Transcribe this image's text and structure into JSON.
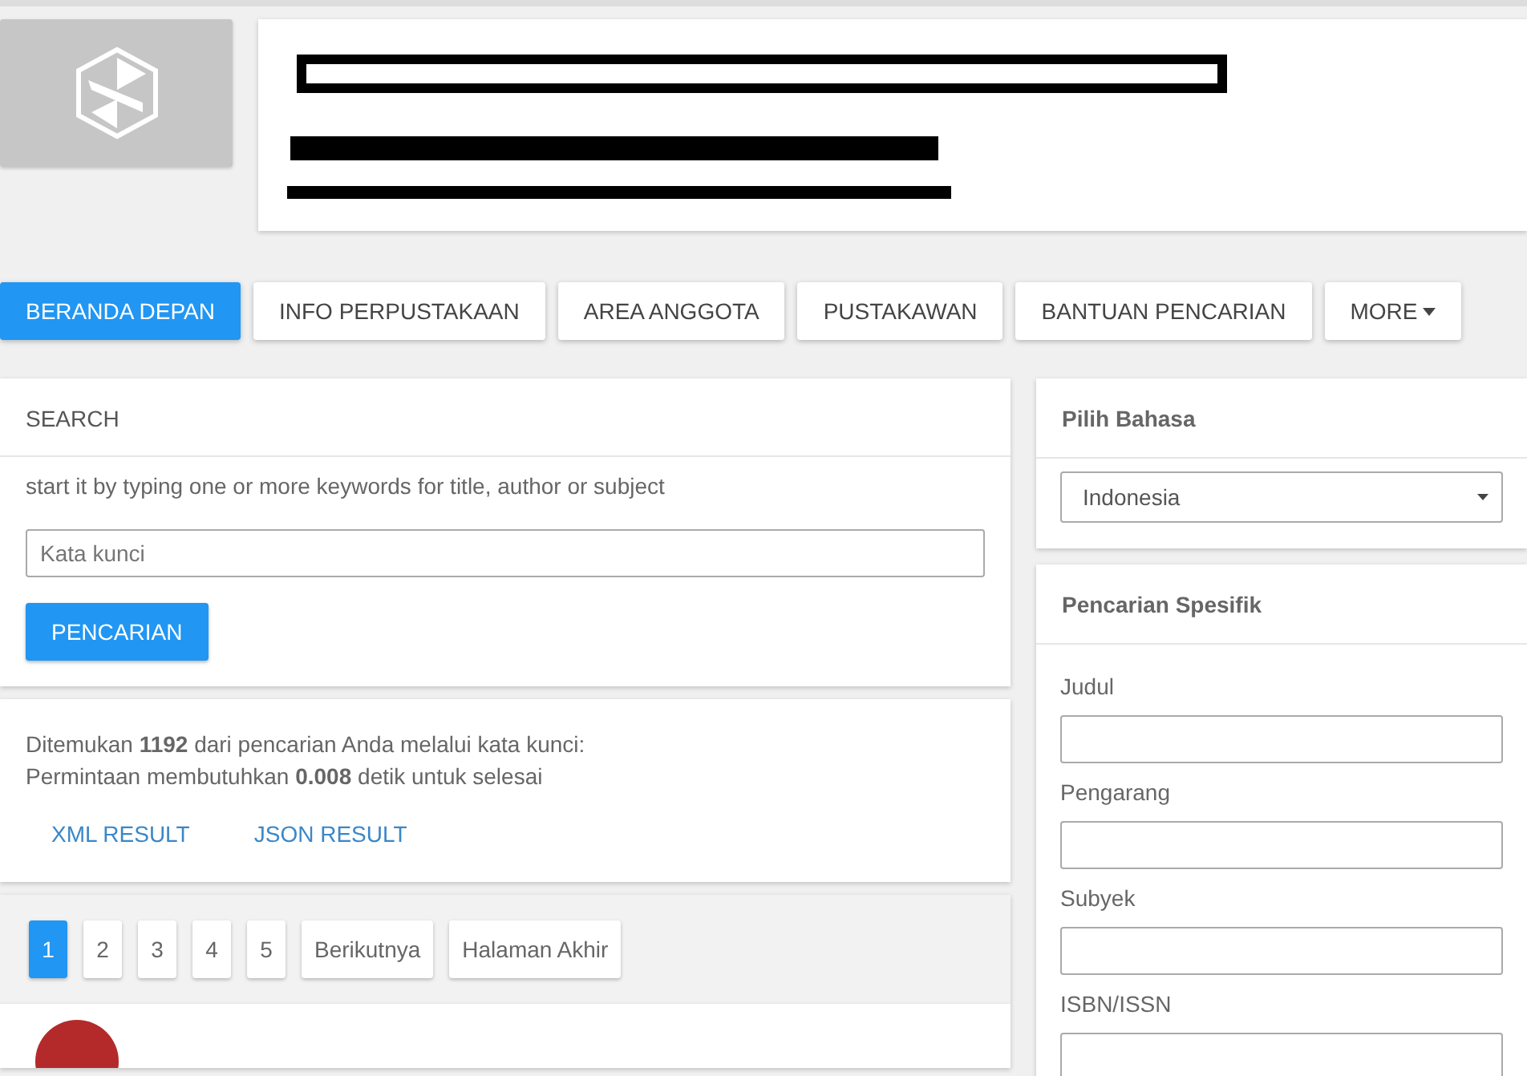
{
  "nav": [
    {
      "label": "BERANDA DEPAN",
      "selected": true
    },
    {
      "label": "INFO PERPUSTAKAAN",
      "selected": false
    },
    {
      "label": "AREA ANGGOTA",
      "selected": false
    },
    {
      "label": "PUSTAKAWAN",
      "selected": false
    },
    {
      "label": "BANTUAN PENCARIAN",
      "selected": false
    },
    {
      "label": "MORE",
      "selected": false,
      "dropdown": true
    }
  ],
  "search": {
    "title": "SEARCH",
    "hint": "start it by typing one or more keywords for title, author or subject",
    "placeholder": "Kata kunci",
    "button": "PENCARIAN"
  },
  "results_info": {
    "lines": [
      "Ditemukan **1192** dari pencarian Anda melalui kata kunci:",
      "Permintaan membutuhkan **0.008** detik untuk selesai"
    ],
    "links": [
      "XML RESULT",
      "JSON RESULT"
    ]
  },
  "pagination": [
    {
      "label": "1",
      "selected": true
    },
    {
      "label": "2",
      "selected": false
    },
    {
      "label": "3",
      "selected": false
    },
    {
      "label": "4",
      "selected": false
    },
    {
      "label": "5",
      "selected": false
    },
    {
      "label": "Berikutnya",
      "selected": false
    },
    {
      "label": "Halaman Akhir",
      "selected": false
    }
  ],
  "language": {
    "title": "Pilih Bahasa",
    "value": "Indonesia"
  },
  "specific_search": {
    "title": "Pencarian Spesifik",
    "fields": [
      "Judul",
      "Pengarang",
      "Subyek",
      "ISBN/ISSN"
    ]
  }
}
